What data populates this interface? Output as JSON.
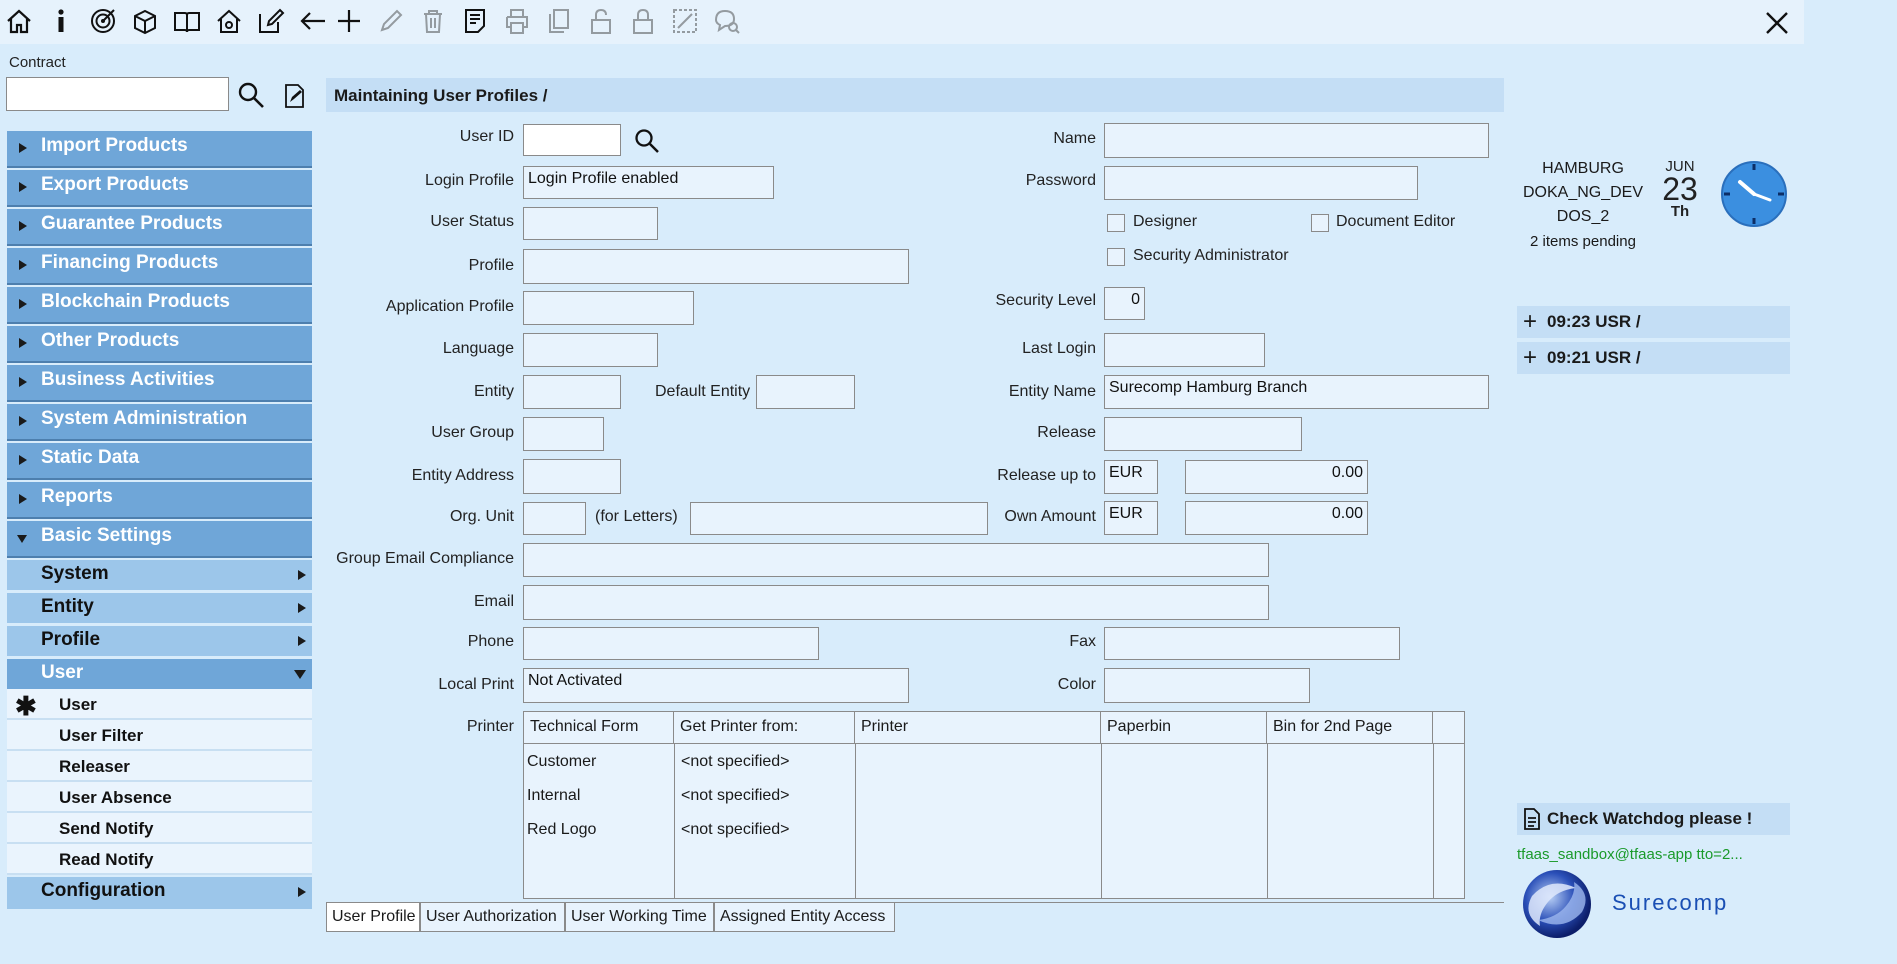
{
  "toolbar": {
    "icons": [
      "home-icon",
      "info-icon",
      "target-icon",
      "box-export-icon",
      "book-icon",
      "house-settings-icon",
      "edit-icon",
      "back-arrow-icon",
      "add-icon",
      "pencil-icon",
      "trash-icon",
      "document-list-icon",
      "print-icon",
      "copy-icon",
      "unlock-icon",
      "lock-icon",
      "rubber-stamp-icon",
      "search-chat-icon"
    ],
    "close": "close-icon"
  },
  "contract": {
    "label": "Contract",
    "value": ""
  },
  "sidebar": {
    "top_items": [
      "Import Products",
      "Export Products",
      "Guarantee Products",
      "Financing Products",
      "Blockchain Products",
      "Other Products",
      "Business Activities",
      "System Administration",
      "Static Data",
      "Reports",
      "Basic Settings"
    ],
    "sub_items": [
      "System",
      "Entity",
      "Profile",
      "User"
    ],
    "user_items": [
      "User",
      "User Filter",
      "Releaser",
      "User Absence",
      "Send Notify",
      "Read Notify"
    ],
    "configuration": "Configuration"
  },
  "form": {
    "title": "Maintaining User Profiles /",
    "labels": {
      "user_id": "User ID",
      "login_profile": "Login Profile",
      "user_status": "User Status",
      "profile": "Profile",
      "application_profile": "Application Profile",
      "language": "Language",
      "entity": "Entity",
      "default_entity": "Default Entity",
      "user_group": "User Group",
      "entity_address": "Entity Address",
      "org_unit": "Org. Unit",
      "for_letters": "(for Letters)",
      "group_email": "Group Email Compliance",
      "email": "Email",
      "phone": "Phone",
      "local_print": "Local Print",
      "printer": "Printer",
      "name": "Name",
      "password": "Password",
      "designer": "Designer",
      "document_editor": "Document Editor",
      "security_admin": "Security Administrator",
      "security_level": "Security Level",
      "last_login": "Last Login",
      "entity_name": "Entity Name",
      "release": "Release",
      "release_up_to": "Release up to",
      "own_amount": "Own Amount",
      "fax": "Fax",
      "color": "Color"
    },
    "values": {
      "user_id": "",
      "login_profile": "Login Profile enabled",
      "security_level": "0",
      "entity_name": "Surecomp Hamburg Branch",
      "release_currency": "EUR",
      "release_amount": "0.00",
      "own_currency": "EUR",
      "own_amount": "0.00",
      "local_print": "Not Activated"
    },
    "printer_table": {
      "headers": [
        "Technical Form",
        "Get Printer from:",
        "Printer",
        "Paperbin",
        "Bin for 2nd Page"
      ],
      "rows": [
        [
          "Customer",
          "<not specified>"
        ],
        [
          "Internal",
          "<not specified>"
        ],
        [
          "Red Logo",
          "<not specified>"
        ]
      ]
    },
    "tabs": [
      "User Profile",
      "User Authorization",
      "User Working Time",
      "Assigned Entity Access"
    ]
  },
  "right_panel": {
    "location": "HAMBURG",
    "env": "DOKA_NG_DEV",
    "db": "DOS_2",
    "pending": "2 items pending",
    "month": "JUN",
    "day": "23",
    "weekday": "Th",
    "tasks": [
      {
        "time": "09:23",
        "label": "USR /"
      },
      {
        "time": "09:21",
        "label": "USR /"
      }
    ],
    "watchdog": "Check Watchdog please !",
    "session": "tfaas_sandbox@tfaas-app tto=2...",
    "brand": "Surecomp",
    "brand_color": "#1a4fb4",
    "session_color": "#1a9a2a"
  }
}
